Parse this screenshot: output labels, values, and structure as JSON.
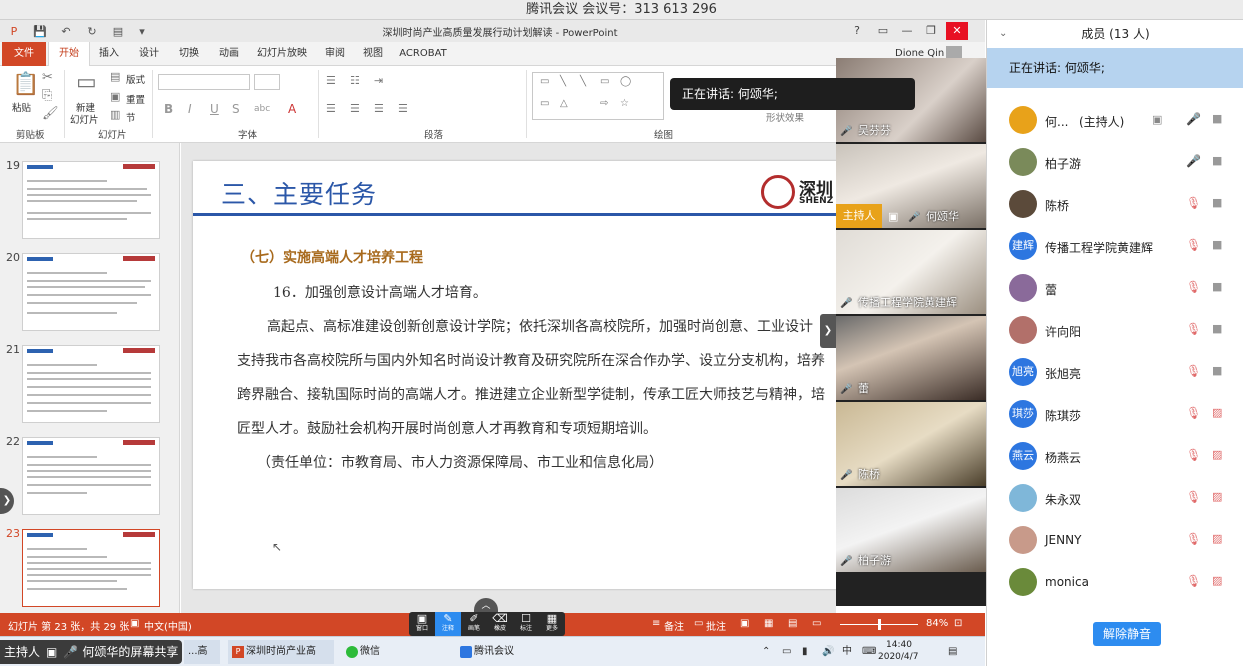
{
  "meeting_title": "腾讯会议 会议号：313 613 296",
  "ppt": {
    "doc_title": "深圳时尚产业高质量发展行动计划解读 - PowerPoint",
    "user": "Dione Qin",
    "help": "?",
    "win": {
      "min": "—",
      "max": "❐",
      "close": "✕"
    },
    "tabs": [
      "文件",
      "开始",
      "插入",
      "设计",
      "切换",
      "动画",
      "幻灯片放映",
      "审阅",
      "视图",
      "ACROBAT"
    ],
    "ribbon": {
      "paste": "粘贴",
      "clipboard": "剪贴板",
      "new_slide_1": "新建",
      "new_slide_2": "幻灯片",
      "layout": "版式",
      "reset": "重置",
      "section": "节",
      "slides": "幻灯片",
      "font": "字体",
      "paragraph": "段落",
      "drawing": "绘图",
      "shape_effects": "形状效果"
    },
    "thumbs": [
      {
        "num": "19"
      },
      {
        "num": "20"
      },
      {
        "num": "21"
      },
      {
        "num": "22"
      },
      {
        "num": "23"
      }
    ],
    "slide": {
      "title": "三、主要任务",
      "logo_text": "深圳",
      "logo_sub": "SHENZ",
      "heading": "（七）实施高端人才培养工程",
      "item": "16．加强创意设计高端人才培育。",
      "p1": "高起点、高标准建设创新创意设计学院；依托深圳各高校院所，加强时尚创意、工业设计",
      "p2": "支持我市各高校院所与国内外知名时尚设计教育及研究院所在深合作办学、设立分支机构，培养",
      "p3": "跨界融合、接轨国际时尚的高端人才。推进建立企业新型学徒制，传承工匠大师技艺与精神，培",
      "p4": "匠型人才。鼓励社会机构开展时尚创意人才再教育和专项短期培训。",
      "resp": "（责任单位：市教育局、市人力资源保障局、市工业和信息化局）"
    },
    "status": {
      "slide_info": "幻灯片 第 23 张，共 29 张",
      "lang": "中文(中国)",
      "notes": "备注",
      "comments": "批注",
      "zoom": "84%"
    }
  },
  "share_toolbar": [
    {
      "icon": "▣",
      "label": "窗口"
    },
    {
      "icon": "✎",
      "label": "注释"
    },
    {
      "icon": "✐",
      "label": "画笔"
    },
    {
      "icon": "⌫",
      "label": "橡皮"
    },
    {
      "icon": "☐",
      "label": "标注"
    },
    {
      "icon": "▦",
      "label": "更多"
    }
  ],
  "share_pill": "何颂华的屏幕共享",
  "share_pill_role": "主持人",
  "taskbar": {
    "item1": "...高质...",
    "item2": "深圳时尚产业高质...",
    "item3": "微信",
    "item4": "腾讯会议",
    "ime": "中",
    "time": "14:40",
    "date": "2020/4/7"
  },
  "video": {
    "speaking_tip": "正在讲话: 何颂华;",
    "tiles": [
      {
        "name": "吴芬芬",
        "muted": true
      },
      {
        "name": "何颂华",
        "host_badge": "主持人",
        "muted": false
      },
      {
        "name": "传播工程学院黄建辉",
        "muted": true
      },
      {
        "name": "蕾",
        "muted": true
      },
      {
        "name": "陈桥",
        "muted": true
      },
      {
        "name": "柏子游",
        "muted": false
      }
    ]
  },
  "members": {
    "title": "成员 (13 人)",
    "speaking": "正在讲话: 何颂华;",
    "unmute_all": "解除静音",
    "rows": [
      {
        "name": "何...",
        "host": "(主持人)",
        "avatar": "",
        "color": "#e8a21a",
        "mic": "on",
        "cam": "on",
        "screen": true
      },
      {
        "name": "柏子游",
        "avatar": "",
        "color": "#7a8a5a",
        "mic": "on",
        "cam": "on"
      },
      {
        "name": "陈桥",
        "avatar": "",
        "color": "#5b4a3a",
        "mic": "off",
        "cam": "on"
      },
      {
        "name": "传播工程学院黄建辉",
        "avatar": "建辉",
        "color": "#2d76e0",
        "mic": "off",
        "cam": "on"
      },
      {
        "name": "蕾",
        "avatar": "",
        "color": "#8a6a9a",
        "mic": "off",
        "cam": "on"
      },
      {
        "name": "许向阳",
        "avatar": "",
        "color": "#b2706a",
        "mic": "off",
        "cam": "on"
      },
      {
        "name": "张旭亮",
        "avatar": "旭亮",
        "color": "#2d76e0",
        "mic": "off",
        "cam": "on"
      },
      {
        "name": "陈琪莎",
        "avatar": "琪莎",
        "color": "#2d76e0",
        "mic": "off",
        "cam": "off"
      },
      {
        "name": "杨燕云",
        "avatar": "燕云",
        "color": "#2d76e0",
        "mic": "off",
        "cam": "off"
      },
      {
        "name": "朱永双",
        "avatar": "",
        "color": "#7fb7d9",
        "mic": "off",
        "cam": "off"
      },
      {
        "name": "JENNY",
        "avatar": "",
        "color": "#c89a8a",
        "mic": "off",
        "cam": "off"
      },
      {
        "name": "monica",
        "avatar": "",
        "color": "#6a8a3a",
        "mic": "off",
        "cam": "off"
      }
    ]
  }
}
